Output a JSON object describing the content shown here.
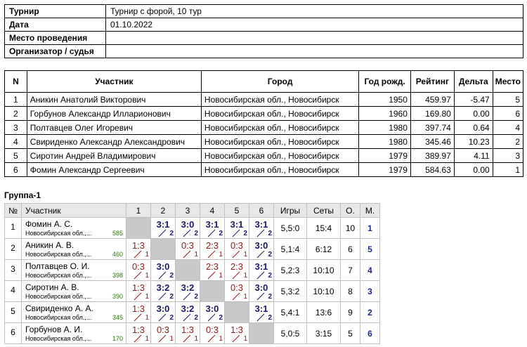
{
  "info": [
    {
      "label": "Турнир",
      "value": "Турнир с форой, 10 тур"
    },
    {
      "label": "Дата",
      "value": "01.10.2022"
    },
    {
      "label": "Место проведения",
      "value": ""
    },
    {
      "label": "Организатор / судья",
      "value": ""
    }
  ],
  "participants": {
    "headers": [
      "N",
      "Участник",
      "Город",
      "Год рожд.",
      "Рейтинг",
      "Дельта",
      "Место"
    ],
    "rows": [
      [
        "1",
        "Аникин Анатолий Викторович",
        "Новосибирская обл., Новосибирск",
        "1950",
        "459.97",
        "-5.47",
        "5"
      ],
      [
        "2",
        "Горбунов Александр Илларионович",
        "Новосибирская обл., Новосибирск",
        "1960",
        "169.80",
        "0.00",
        "6"
      ],
      [
        "3",
        "Полтавцев Олег Игоревич",
        "Новосибирская обл., Новосибирск",
        "1980",
        "397.74",
        "0.64",
        "4"
      ],
      [
        "4",
        "Свириденко Александр Александрович",
        "Новосибирская обл., Новосибирск",
        "1980",
        "345.46",
        "10.23",
        "2"
      ],
      [
        "5",
        "Сиротин Андрей Владимирович",
        "Новосибирская обл., Новосибирск",
        "1979",
        "389.97",
        "4.11",
        "3"
      ],
      [
        "6",
        "Фомин Александр Сергеевич",
        "Новосибирская обл., Новосибирск",
        "1979",
        "584.63",
        "0.00",
        "1"
      ]
    ]
  },
  "group": {
    "title": "Группа-1",
    "headers": [
      "№",
      "Участник",
      "1",
      "2",
      "3",
      "4",
      "5",
      "6",
      "Игры",
      "Сеты",
      "О.",
      "М."
    ],
    "rows": [
      {
        "n": "1",
        "name": "Фомин А. С.",
        "city": "Новосибирская обл.,...",
        "rating": "585",
        "results": [
          null,
          {
            "s": "3:1",
            "p": "2"
          },
          {
            "s": "3:0",
            "p": "2"
          },
          {
            "s": "3:1",
            "p": "2"
          },
          {
            "s": "3:1",
            "p": "2"
          },
          {
            "s": "3:1",
            "p": "2"
          }
        ],
        "games": "5,5:0",
        "sets": "15:4",
        "points": "10",
        "place": "1"
      },
      {
        "n": "2",
        "name": "Аникин А. В.",
        "city": "Новосибирская обл.,...",
        "rating": "460",
        "results": [
          {
            "s": "1:3",
            "p": "1"
          },
          null,
          {
            "s": "0:3",
            "p": "1"
          },
          {
            "s": "2:3",
            "p": "1"
          },
          {
            "s": "0:3",
            "p": "1"
          },
          {
            "s": "3:0",
            "p": "2"
          }
        ],
        "games": "5,1:4",
        "sets": "6:12",
        "points": "6",
        "place": "5"
      },
      {
        "n": "3",
        "name": "Полтавцев О. И.",
        "city": "Новосибирская обл.,...",
        "rating": "398",
        "results": [
          {
            "s": "0:3",
            "p": "1"
          },
          {
            "s": "3:0",
            "p": "2"
          },
          null,
          {
            "s": "2:3",
            "p": "1"
          },
          {
            "s": "2:3",
            "p": "1"
          },
          {
            "s": "3:1",
            "p": "2"
          }
        ],
        "games": "5,2:3",
        "sets": "10:10",
        "points": "7",
        "place": "4"
      },
      {
        "n": "4",
        "name": "Сиротин А. В.",
        "city": "Новосибирская обл.,...",
        "rating": "390",
        "results": [
          {
            "s": "1:3",
            "p": "1"
          },
          {
            "s": "3:2",
            "p": "2"
          },
          {
            "s": "3:2",
            "p": "2"
          },
          null,
          {
            "s": "0:3",
            "p": "1"
          },
          {
            "s": "3:0",
            "p": "2"
          }
        ],
        "games": "5,3:2",
        "sets": "10:10",
        "points": "8",
        "place": "3"
      },
      {
        "n": "5",
        "name": "Свириденко А. А.",
        "city": "Новосибирская обл.,...",
        "rating": "345",
        "results": [
          {
            "s": "1:3",
            "p": "1"
          },
          {
            "s": "3:0",
            "p": "2"
          },
          {
            "s": "3:2",
            "p": "2"
          },
          {
            "s": "3:0",
            "p": "2"
          },
          null,
          {
            "s": "3:1",
            "p": "2"
          }
        ],
        "games": "5,4:1",
        "sets": "13:6",
        "points": "9",
        "place": "2"
      },
      {
        "n": "6",
        "name": "Горбунов А. И.",
        "city": "Новосибирская обл.,...",
        "rating": "170",
        "results": [
          {
            "s": "1:3",
            "p": "1"
          },
          {
            "s": "0:3",
            "p": "1"
          },
          {
            "s": "1:3",
            "p": "1"
          },
          {
            "s": "0:3",
            "p": "1"
          },
          {
            "s": "1:3",
            "p": "1"
          },
          null
        ],
        "games": "5,0:5",
        "sets": "3:15",
        "points": "5",
        "place": "6"
      }
    ]
  }
}
